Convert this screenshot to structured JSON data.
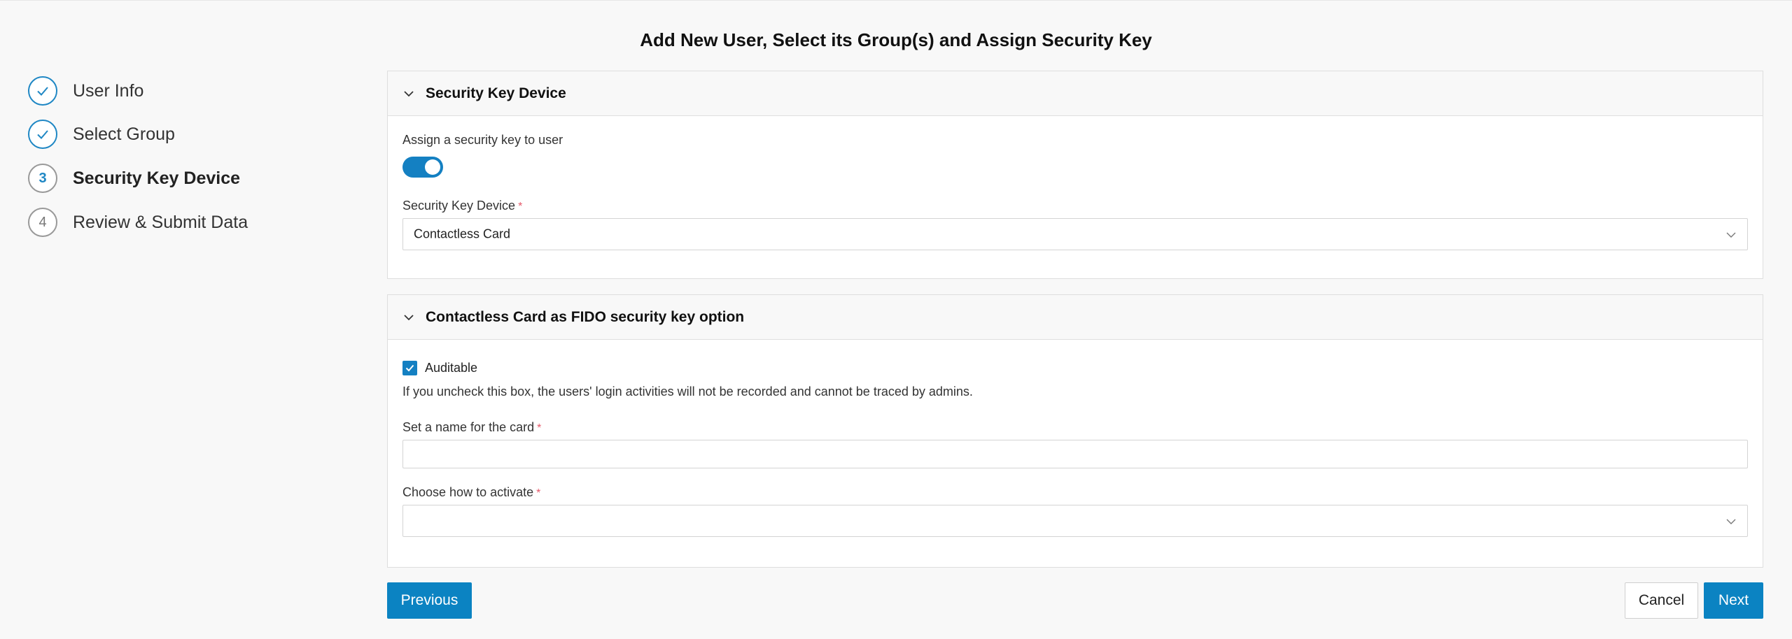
{
  "page": {
    "title": "Add New User, Select its Group(s) and Assign Security Key"
  },
  "stepper": {
    "steps": [
      {
        "label": "User Info",
        "status": "done",
        "number": "1"
      },
      {
        "label": "Select Group",
        "status": "done",
        "number": "2"
      },
      {
        "label": "Security Key Device",
        "status": "current",
        "number": "3"
      },
      {
        "label": "Review & Submit Data",
        "status": "pending",
        "number": "4"
      }
    ]
  },
  "security_panel": {
    "title": "Security Key Device",
    "assign_label": "Assign a security key to user",
    "assign_enabled": true,
    "device_label": "Security Key Device",
    "required_mark": "*",
    "device_value": "Contactless Card"
  },
  "fido_panel": {
    "title": "Contactless Card as FIDO security key option",
    "auditable_label": "Auditable",
    "auditable_checked": true,
    "help_text": "If you uncheck this box, the users' login activities will not be recorded and cannot be traced by admins.",
    "card_name_label": "Set a name for the card",
    "card_name_value": "",
    "activate_label": "Choose how to activate",
    "activate_value": "",
    "required_mark": "*"
  },
  "actions": {
    "previous_label": "Previous",
    "cancel_label": "Cancel",
    "next_label": "Next"
  },
  "colors": {
    "primary": "#0b83c2",
    "required": "#e5596a",
    "step_done_border": "#1f87c4"
  }
}
